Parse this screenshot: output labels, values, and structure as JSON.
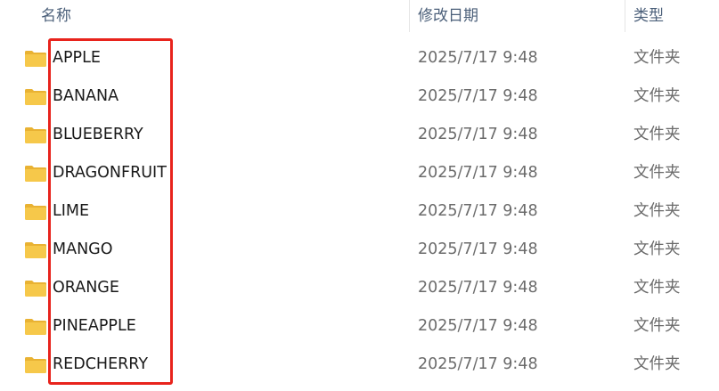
{
  "columns": {
    "name": "名称",
    "date_modified": "修改日期",
    "type": "类型"
  },
  "sort_indicator": "^",
  "icon": "folder-icon",
  "colors": {
    "highlight": "#e8231c",
    "folder_body": "#f6c84a",
    "folder_tab": "#e9b233"
  },
  "files": [
    {
      "name": "APPLE",
      "date": "2025/7/17 9:48",
      "type": "文件夹"
    },
    {
      "name": "BANANA",
      "date": "2025/7/17 9:48",
      "type": "文件夹"
    },
    {
      "name": "BLUEBERRY",
      "date": "2025/7/17 9:48",
      "type": "文件夹"
    },
    {
      "name": "DRAGONFRUIT",
      "date": "2025/7/17 9:48",
      "type": "文件夹"
    },
    {
      "name": "LIME",
      "date": "2025/7/17 9:48",
      "type": "文件夹"
    },
    {
      "name": "MANGO",
      "date": "2025/7/17 9:48",
      "type": "文件夹"
    },
    {
      "name": "ORANGE",
      "date": "2025/7/17 9:48",
      "type": "文件夹"
    },
    {
      "name": "PINEAPPLE",
      "date": "2025/7/17 9:48",
      "type": "文件夹"
    },
    {
      "name": "REDCHERRY",
      "date": "2025/7/17 9:48",
      "type": "文件夹"
    }
  ]
}
